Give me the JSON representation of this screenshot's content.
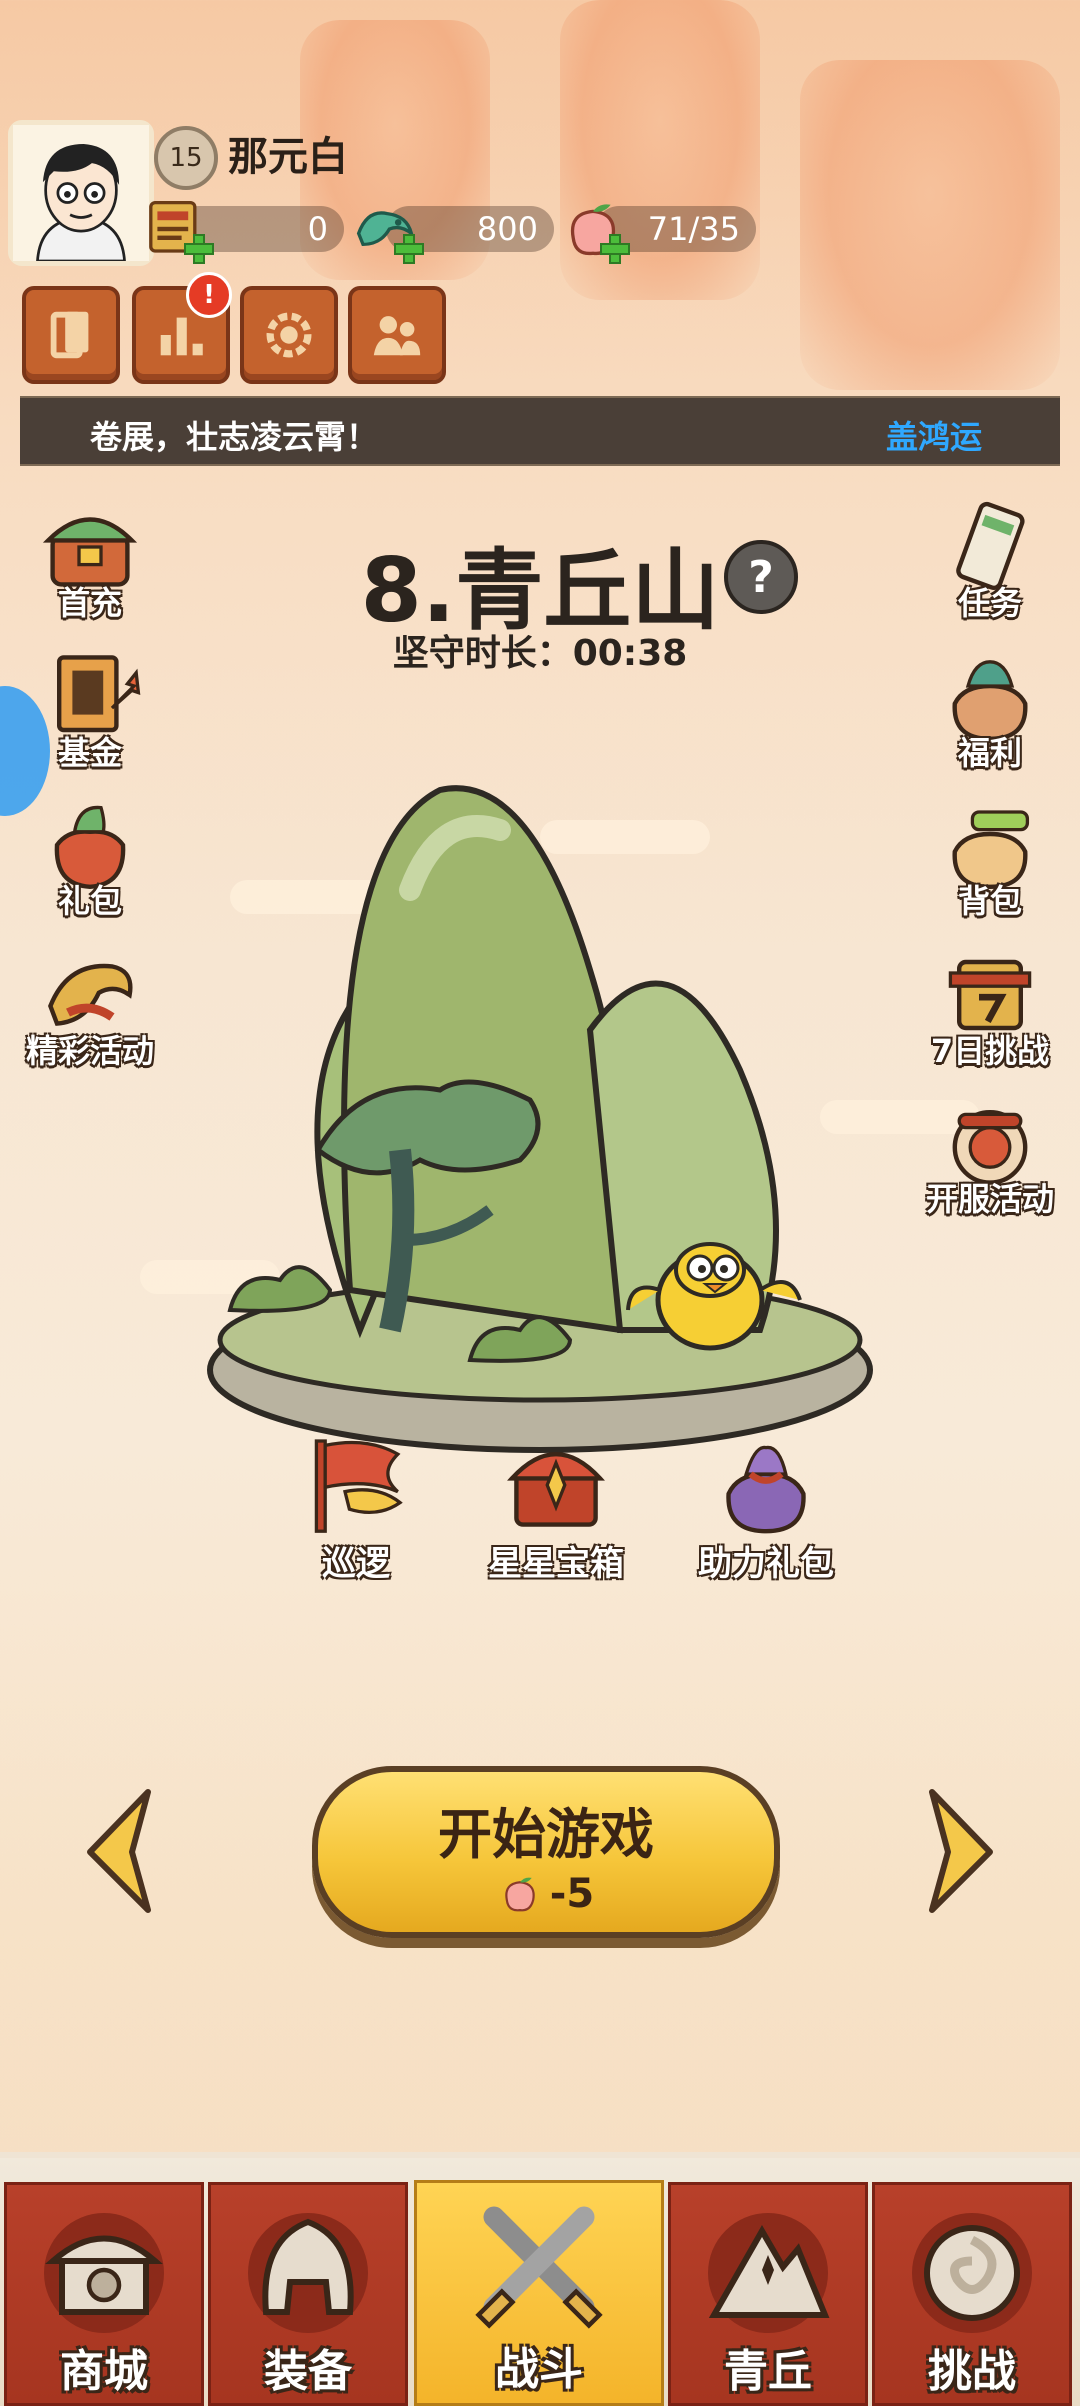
{
  "player": {
    "level": "15",
    "name": "那元白"
  },
  "resources": [
    {
      "name": "tickets",
      "value": "0",
      "icon": "ticket-icon"
    },
    {
      "name": "jade",
      "value": "800",
      "icon": "jade-dragon-icon"
    },
    {
      "name": "stamina",
      "value": "71/35",
      "icon": "peach-icon"
    }
  ],
  "toolbar": {
    "alert_mark": "!"
  },
  "marquee": {
    "left_text": "卷展，壮志凌云霄！",
    "right_text": "盖鸿运"
  },
  "left_menu": [
    {
      "label": "首充"
    },
    {
      "label": "基金"
    },
    {
      "label": "礼包"
    },
    {
      "label": "精彩活动"
    }
  ],
  "right_menu": [
    {
      "label": "任务"
    },
    {
      "label": "福利"
    },
    {
      "label": "背包"
    },
    {
      "label": "7日挑战"
    },
    {
      "label": "开服活动"
    }
  ],
  "stage": {
    "title": "8.青丘山",
    "help": "?",
    "guard_label": "坚守时长：",
    "guard_time": "00:38"
  },
  "scene_items": [
    {
      "label": "巡逻"
    },
    {
      "label": "星星宝箱"
    },
    {
      "label": "助力礼包"
    }
  ],
  "start": {
    "label": "开始游戏",
    "cost": "-5"
  },
  "nav": [
    {
      "label": "商城"
    },
    {
      "label": "装备"
    },
    {
      "label": "战斗"
    },
    {
      "label": "青丘"
    },
    {
      "label": "挑战"
    }
  ],
  "colors": {
    "accent_gold": "#f6c63a",
    "nav_red": "#b8402a",
    "marquee_blue": "#2fa8ff"
  }
}
